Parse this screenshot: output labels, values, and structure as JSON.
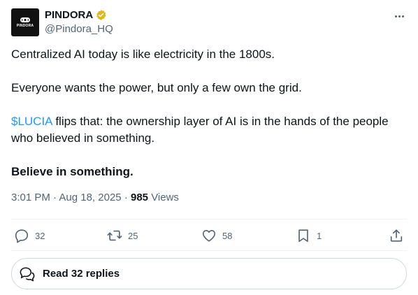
{
  "author": {
    "display_name": "PINDORA",
    "handle": "@Pindora_HQ",
    "avatar_text": "PINDORA",
    "verified_color": "#e2b719"
  },
  "post": {
    "line1": "Centralized AI today is like electricity in the 1800s.",
    "line2": "Everyone wants the power, but only a few own the grid.",
    "cashtag": "$LUCIA",
    "line3_rest": " flips that: the ownership layer of AI is in the hands of the people who believed in something.",
    "line4": "Believe in something."
  },
  "meta": {
    "time": "3:01 PM",
    "separator": "·",
    "date": "Aug 18, 2025",
    "views_count": "985",
    "views_label": "Views"
  },
  "actions": {
    "replies": "32",
    "reposts": "25",
    "likes": "58",
    "bookmarks": "1"
  },
  "read_replies": {
    "label": "Read 32 replies"
  },
  "colors": {
    "accent": "#1d9bf0",
    "secondary_text": "#536471",
    "primary_text": "#0f1419",
    "border": "#cfd9de"
  }
}
